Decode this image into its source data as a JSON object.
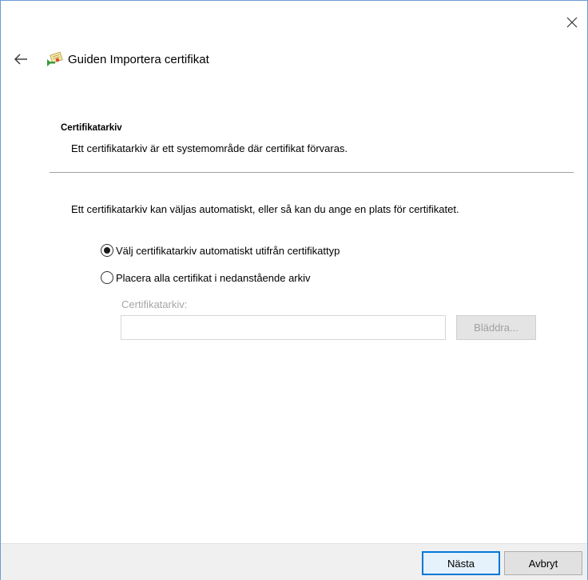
{
  "window": {
    "title": "Guiden Importera certifikat",
    "icons": {
      "close": "close-icon",
      "back": "back-arrow-icon",
      "wizard": "certificate-wizard-icon"
    }
  },
  "section": {
    "heading": "Certifikatarkiv",
    "description": "Ett certifikatarkiv är ett systemområde där certifikat förvaras."
  },
  "content": {
    "intro": "Ett certifikatarkiv kan väljas automatiskt, eller så kan du ange en plats för certifikatet.",
    "options": [
      {
        "label": "Välj certifikatarkiv automatiskt utifrån certifikattyp",
        "selected": true
      },
      {
        "label": "Placera alla certifikat i nedanstående arkiv",
        "selected": false
      }
    ],
    "store_label": "Certifikatarkiv:",
    "store_value": "",
    "browse_label": "Bläddra..."
  },
  "footer": {
    "next_label": "Nästa",
    "cancel_label": "Avbryt"
  },
  "colors": {
    "accent": "#0078d7",
    "disabled_text": "#a0a0a0",
    "footer_bg": "#f0f0f0"
  }
}
